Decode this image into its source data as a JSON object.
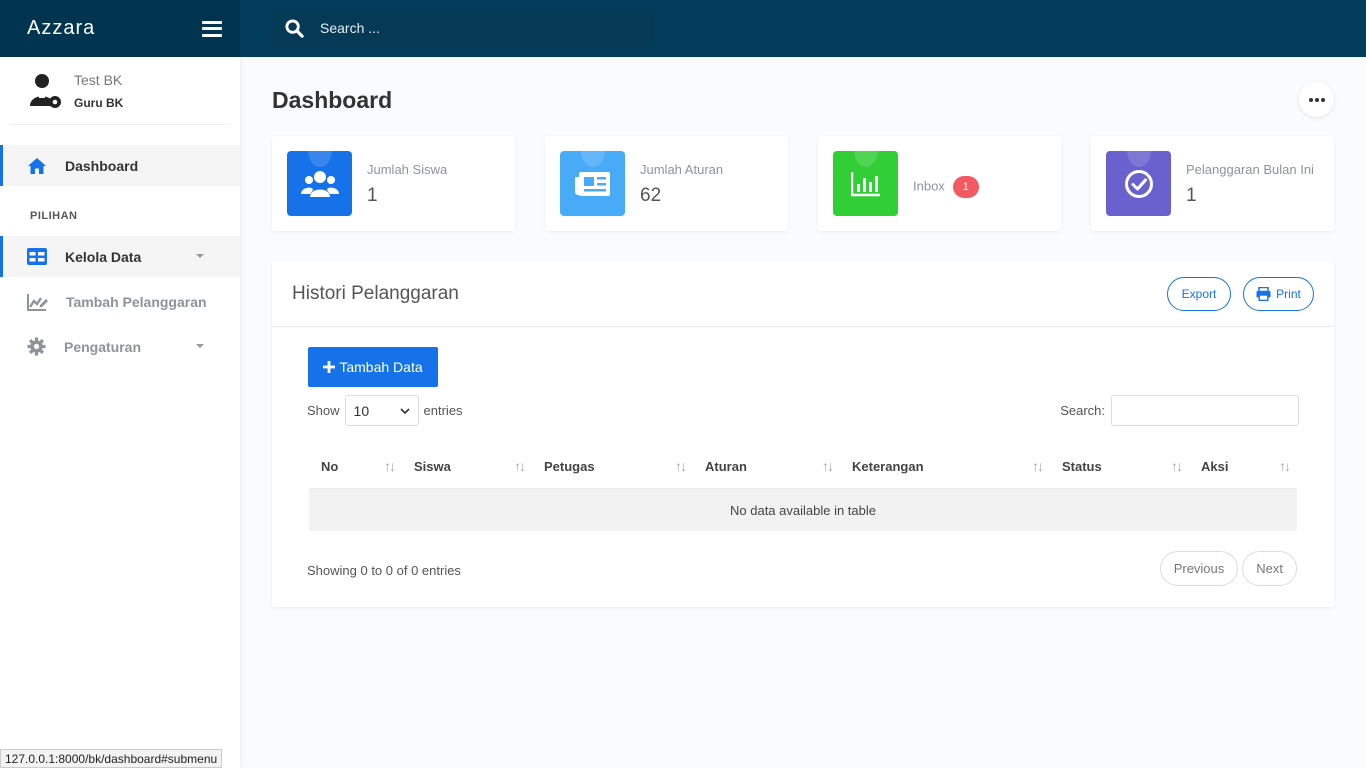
{
  "topbar": {
    "brand": "Azzara",
    "search_placeholder": "Search ...",
    "bg_color": "#023d5c"
  },
  "user": {
    "name": "Test BK",
    "role": "Guru BK"
  },
  "sidebar": {
    "items": [
      {
        "label": "Dashboard",
        "icon": "home-icon",
        "active": true
      }
    ],
    "section_title": "PILIHAN",
    "section_items": [
      {
        "label": "Kelola Data",
        "icon": "table-icon",
        "has_submenu": true
      },
      {
        "label": "Tambah Pelanggaran",
        "icon": "chart-edit-icon",
        "has_submenu": false
      },
      {
        "label": "Pengaturan",
        "icon": "gear-icon",
        "has_submenu": true
      }
    ]
  },
  "page": {
    "title": "Dashboard"
  },
  "stats": [
    {
      "label": "Jumlah Siswa",
      "value": "1",
      "icon": "users-icon",
      "color": "#1572e8"
    },
    {
      "label": "Jumlah Aturan",
      "value": "62",
      "icon": "newspaper-icon",
      "color": "#48abf7"
    },
    {
      "label": "Inbox",
      "badge": "1",
      "icon": "bar-chart-icon",
      "color": "#31ce36"
    },
    {
      "label": "Pelanggaran Bulan Ini",
      "value": "1",
      "icon": "check-circle-icon",
      "color": "#6861ce"
    }
  ],
  "panel": {
    "title": "Histori Pelanggaran",
    "export_label": "Export",
    "print_label": "Print",
    "add_label": "Tambah Data",
    "show_label": "Show",
    "show_value": "10",
    "entries_label": "entries",
    "search_label": "Search:",
    "columns": [
      "No",
      "Siswa",
      "Petugas",
      "Aturan",
      "Keterangan",
      "Status",
      "Aksi"
    ],
    "empty_text": "No data available in table",
    "info": "Showing 0 to 0 of 0 entries",
    "prev_label": "Previous",
    "next_label": "Next"
  },
  "statusbar": {
    "url": "127.0.0.1:8000/bk/dashboard#submenu"
  }
}
